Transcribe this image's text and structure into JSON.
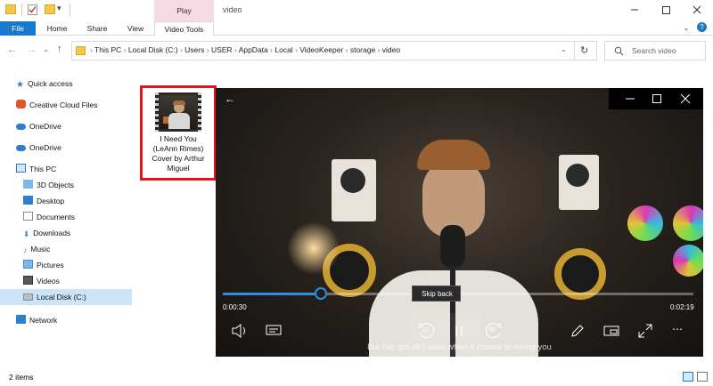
{
  "window": {
    "title": "video"
  },
  "titlebar": {
    "play_tab": "Play",
    "qat_dropdown": "▾"
  },
  "ribbon": {
    "tabs": [
      "File",
      "Home",
      "Share",
      "View",
      "Video Tools"
    ]
  },
  "address": {
    "crumbs": [
      "This PC",
      "Local Disk (C:)",
      "Users",
      "USER",
      "AppData",
      "Local",
      "VideoKeeper",
      "storage",
      "video"
    ],
    "search_placeholder": "Search video"
  },
  "sidebar": {
    "items": [
      {
        "label": "Quick access",
        "icon": "star-icon"
      },
      {
        "label": "Creative Cloud Files",
        "icon": "creative-cloud-icon"
      },
      {
        "label": "OneDrive",
        "icon": "cloud-icon"
      },
      {
        "label": "OneDrive",
        "icon": "cloud-icon"
      },
      {
        "label": "This PC",
        "icon": "computer-icon"
      },
      {
        "label": "3D Objects",
        "icon": "cube-icon"
      },
      {
        "label": "Desktop",
        "icon": "desktop-icon"
      },
      {
        "label": "Documents",
        "icon": "documents-icon"
      },
      {
        "label": "Downloads",
        "icon": "download-icon"
      },
      {
        "label": "Music",
        "icon": "music-icon"
      },
      {
        "label": "Pictures",
        "icon": "pictures-icon"
      },
      {
        "label": "Videos",
        "icon": "videos-icon"
      },
      {
        "label": "Local Disk (C:)",
        "icon": "disk-icon"
      },
      {
        "label": "Network",
        "icon": "network-icon"
      }
    ]
  },
  "file": {
    "name_lines": [
      "I Need You",
      "(LeAnn Rimes)",
      "Cover by Arthur",
      "Miguel"
    ]
  },
  "status": {
    "count": "2 items"
  },
  "player": {
    "elapsed": "0:00:30",
    "remaining": "0:02:19",
    "progress": 0.208,
    "tooltip": "Skip back",
    "skip_back_seconds": "10",
    "skip_forward_seconds": "30",
    "subtitle": "But I've got all I want when it comes to loving you"
  },
  "colors": {
    "accent": "#1979ca",
    "highlight_box": "#e3151a",
    "play_tab_bg": "#f7d9e4",
    "progress": "#2f8ee0"
  }
}
